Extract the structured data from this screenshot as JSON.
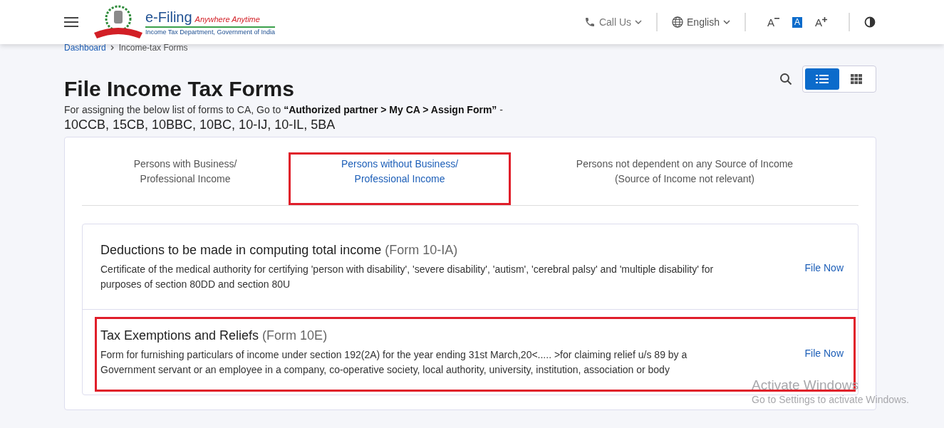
{
  "header": {
    "brand": {
      "title": "e-Filing",
      "tagline": "Anywhere Anytime",
      "subtitle": "Income Tax Department, Government of India"
    },
    "call_us": "Call Us",
    "language": "English",
    "font_sizes": [
      {
        "kind": "decrease",
        "label": "A",
        "selected": false
      },
      {
        "kind": "normal",
        "label": "A",
        "selected": true
      },
      {
        "kind": "increase",
        "label": "A",
        "selected": false
      }
    ]
  },
  "breadcrumb": [
    {
      "label": "Dashboard"
    },
    {
      "label": "Income-tax Forms"
    }
  ],
  "page": {
    "title": "File Income Tax Forms",
    "note": "For assigning the below list of forms to CA, Go to **“Authorized partner > My CA > Assign Form”** -",
    "forms": "10CCB, 15CB, 10BBC, 10BC, 10-IJ, 10-IL, 5BA"
  },
  "view_toggle": [
    {
      "kind": "list",
      "selected": true
    },
    {
      "kind": "grid",
      "selected": false
    }
  ],
  "tabs": [
    {
      "lines": [
        "Persons with Business/",
        "Professional Income"
      ],
      "selected": false,
      "highlighted": false
    },
    {
      "lines": [
        "Persons without Business/",
        "Professional Income"
      ],
      "selected": true,
      "highlighted": true
    },
    {
      "lines": [
        "Persons not dependent on any Source of Income",
        "(Source of Income not relevant)"
      ],
      "selected": false,
      "highlighted": false
    }
  ],
  "forms": [
    {
      "title": "Deductions to be made in computing total income",
      "code": "(Form 10-IA)",
      "description": "Certificate of the medical authority for certifying 'person with disability', 'severe disability', 'autism', 'cerebral palsy' and 'multiple disability' for purposes of section 80DD and section 80U",
      "action": "File Now",
      "highlighted": false
    },
    {
      "title": "Tax Exemptions and Reliefs",
      "code": "(Form 10E)",
      "description": "Form for furnishing particulars of income under section 192(2A) for the year ending 31st March,20<..... >for claiming relief u/s 89 by a Government servant or an employee in a company, co-operative society, local authority, university, institution, association or body",
      "action": "File Now",
      "highlighted": true
    }
  ],
  "os_overlay": {
    "title": "Activate Windows",
    "subtitle": "Go to Settings to activate Windows."
  }
}
